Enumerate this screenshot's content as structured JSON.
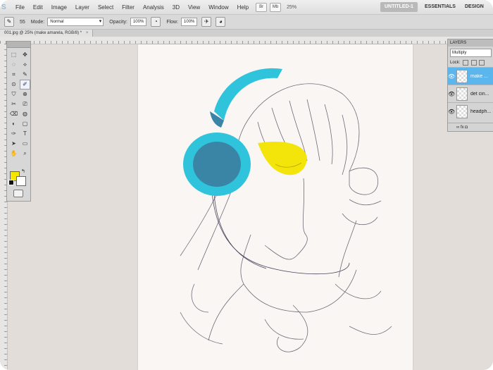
{
  "menubar": {
    "app_logo": "S",
    "items": [
      "File",
      "Edit",
      "Image",
      "Layer",
      "Select",
      "Filter",
      "Analysis",
      "3D",
      "View",
      "Window",
      "Help"
    ],
    "btn_bridge": "Br",
    "btn_minibridge": "Mb",
    "zoom": "25%",
    "workspace_title": "UNTITLED-1",
    "workspace_essentials": "ESSENTIALS",
    "workspace_design": "DESIGN"
  },
  "options": {
    "brush_size": "55",
    "mode_label": "Mode:",
    "mode_value": "Normal",
    "opacity_label": "Opacity:",
    "opacity_value": "100%",
    "flow_label": "Flow:",
    "flow_value": "100%"
  },
  "document": {
    "tab_title": "001.jpg @ 25% (make amarela, RGB/8) *",
    "close_glyph": "×"
  },
  "tools": {
    "glyphs": [
      "⬚",
      "✥",
      "◌",
      "⟡",
      "⌗",
      "✎",
      "⊙",
      "✐",
      "⛉",
      "⊕",
      "✂",
      "⎚",
      "⌫",
      "◍",
      "◐",
      "▢",
      "✑",
      "T",
      "➤",
      "▭",
      "✋",
      "⌕"
    ],
    "swap_glyph": "↰"
  },
  "layers": {
    "title": "LAYERS",
    "blend_mode": "Multiply",
    "lock_label": "Lock:",
    "items": [
      {
        "name": "make ...",
        "visible_glyph": "👁"
      },
      {
        "name": "det cin...",
        "visible_glyph": "👁"
      },
      {
        "name": "headph...",
        "visible_glyph": "👁"
      }
    ],
    "footer": "∞  fx  ◘"
  },
  "colors": {
    "foreground": "#f5e600",
    "background": "#ffffff",
    "headphone_light": "#2fc4dc",
    "headphone_dark": "#3a85a6",
    "eye_yellow": "#f3e50a",
    "layer_selected": "#5bb6ee"
  }
}
